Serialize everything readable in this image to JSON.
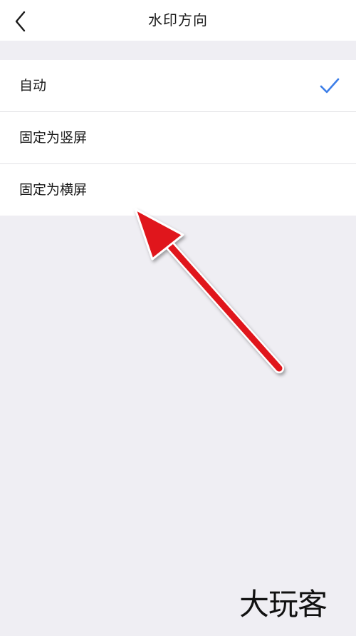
{
  "header": {
    "title": "水印方向",
    "back_icon": "chevron-left-icon"
  },
  "options": [
    {
      "label": "自动",
      "selected": true
    },
    {
      "label": "固定为竖屏",
      "selected": false
    },
    {
      "label": "固定为横屏",
      "selected": false
    }
  ],
  "colors": {
    "accent": "#3c7ee8",
    "arrow": "#e0191c",
    "background": "#efeef3"
  },
  "watermark": {
    "text": "大玩客"
  }
}
